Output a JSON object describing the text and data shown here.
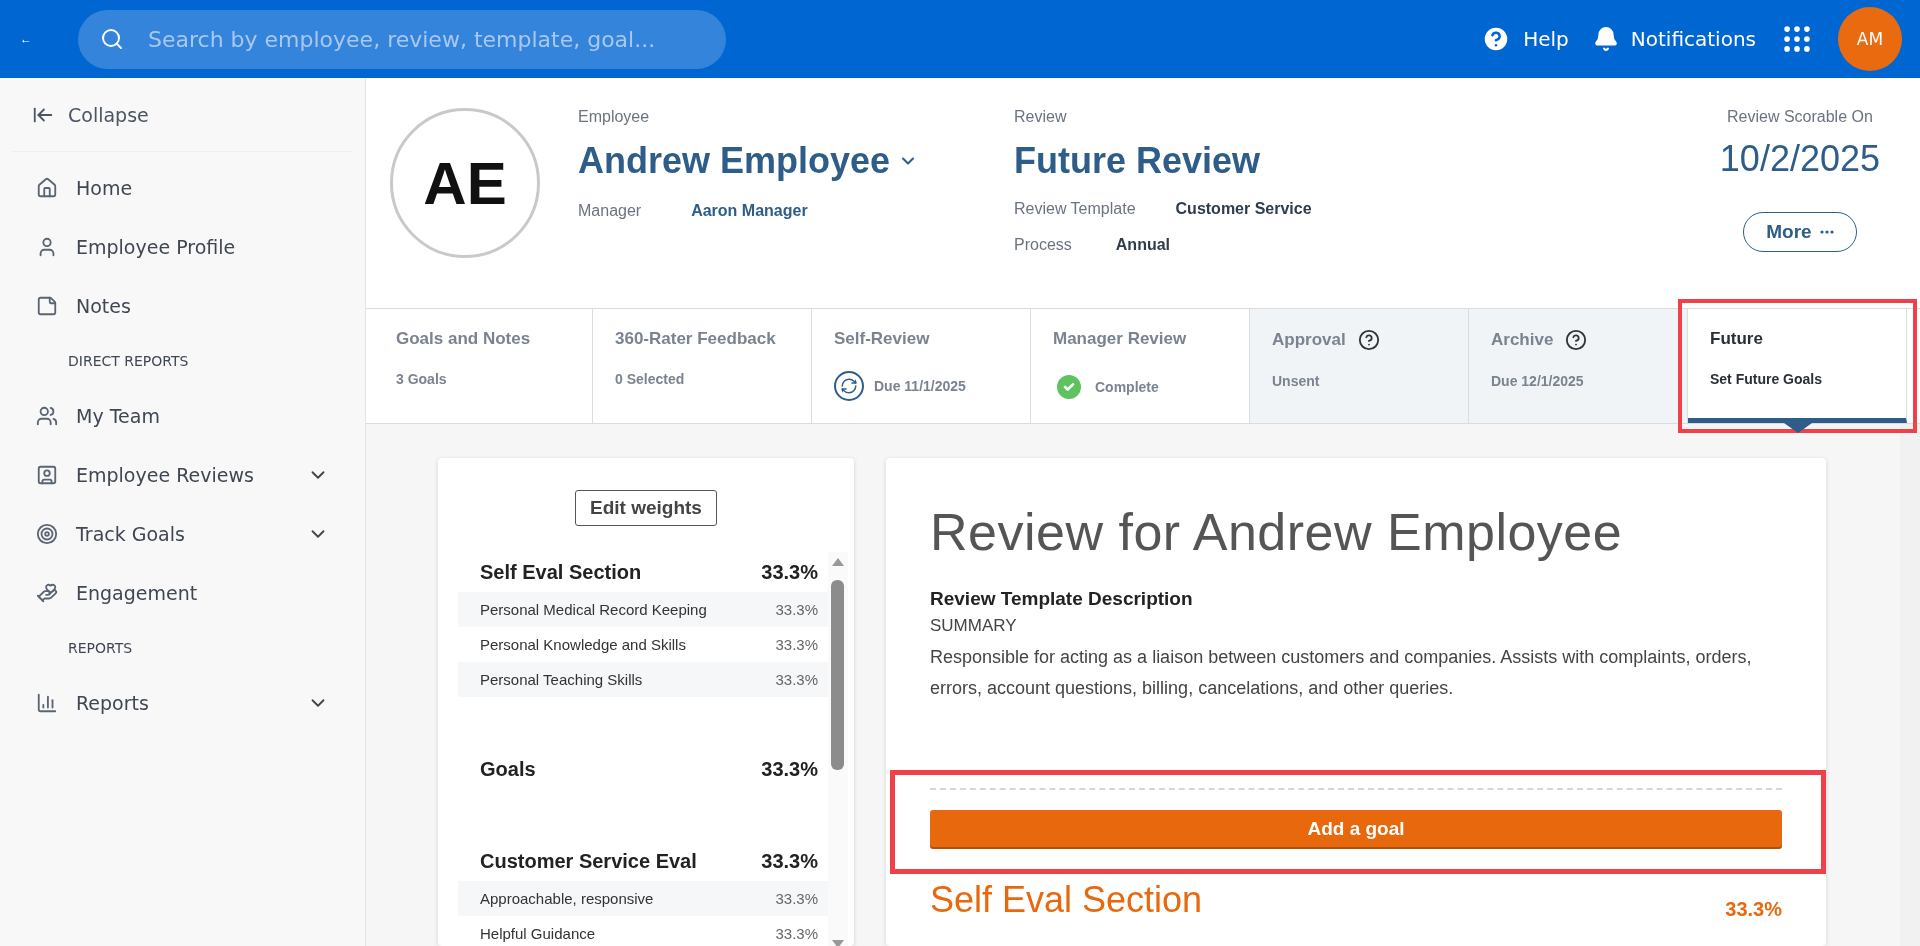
{
  "topbar": {
    "back": "←",
    "search": {
      "placeholder": "Search by employee, review, template, goal..."
    },
    "help": "Help",
    "notifications": "Notifications",
    "avatar": "AM"
  },
  "sidebar": {
    "collapse": "Collapse",
    "items": [
      {
        "kind": "link",
        "label": "Home",
        "expandable": false
      },
      {
        "kind": "link",
        "label": "Employee Profile",
        "expandable": false
      },
      {
        "kind": "link",
        "label": "Notes",
        "expandable": false
      },
      {
        "kind": "heading",
        "label": "DIRECT REPORTS"
      },
      {
        "kind": "link",
        "label": "My Team",
        "expandable": false
      },
      {
        "kind": "link",
        "label": "Employee Reviews",
        "expandable": true
      },
      {
        "kind": "link",
        "label": "Track Goals",
        "expandable": true
      },
      {
        "kind": "link",
        "label": "Engagement",
        "expandable": false
      },
      {
        "kind": "heading",
        "label": "REPORTS"
      },
      {
        "kind": "link",
        "label": "Reports",
        "expandable": true
      }
    ]
  },
  "header": {
    "avatar": "AE",
    "employee_label": "Employee",
    "employee_name": "Andrew Employee",
    "manager_label": "Manager",
    "manager": "Aaron Manager",
    "review_label": "Review",
    "review_name": "Future Review",
    "template_label": "Review Template",
    "template": "Customer Service",
    "process_label": "Process",
    "process": "Annual",
    "scorable_label": "Review Scorable On",
    "scorable_date": "10/2/2025",
    "more_button": "More"
  },
  "tabs": [
    {
      "title": "Goals and Notes",
      "subtitle": "3 Goals",
      "kind": "plain",
      "help": false,
      "disabled": false,
      "selected": false,
      "highlighted": false
    },
    {
      "title": "360-Rater Feedback",
      "subtitle": "0 Selected",
      "kind": "plain",
      "help": false,
      "disabled": false,
      "selected": false,
      "highlighted": false
    },
    {
      "title": "Self-Review",
      "subtitle": "Due 11/1/2025",
      "kind": "sync",
      "help": false,
      "disabled": false,
      "selected": false,
      "highlighted": false
    },
    {
      "title": "Manager Review",
      "subtitle": "Complete",
      "kind": "check",
      "help": false,
      "disabled": false,
      "selected": false,
      "highlighted": false
    },
    {
      "title": "Approval",
      "subtitle": "Unsent",
      "kind": "plain",
      "help": true,
      "disabled": true,
      "selected": false,
      "highlighted": false
    },
    {
      "title": "Archive",
      "subtitle": "Due 12/1/2025",
      "kind": "plain",
      "help": true,
      "disabled": true,
      "selected": false,
      "highlighted": false
    },
    {
      "title": "Future",
      "subtitle": "Set Future Goals",
      "kind": "plain",
      "help": false,
      "disabled": false,
      "selected": true,
      "highlighted": true
    }
  ],
  "weights": {
    "edit_button": "Edit weights",
    "sections": [
      {
        "title": "Self Eval Section",
        "weight": "33.3%",
        "items": [
          {
            "name": "Personal Medical Record Keeping",
            "weight": "33.3%"
          },
          {
            "name": "Personal Knowledge and Skills",
            "weight": "33.3%"
          },
          {
            "name": "Personal Teaching Skills",
            "weight": "33.3%"
          }
        ]
      },
      {
        "title": "Goals",
        "weight": "33.3%"
      },
      {
        "title": "Customer Service Eval",
        "weight": "33.3%",
        "items": [
          {
            "name": "Approachable, responsive",
            "weight": "33.3%"
          },
          {
            "name": "Helpful Guidance",
            "weight": "33.3%"
          }
        ]
      }
    ]
  },
  "review": {
    "title": "Review for Andrew Employee",
    "description_label": "Review Template Description",
    "summary_label": "SUMMARY",
    "summary": "Responsible for acting as a liaison between customers and companies. Assists with complaints, orders, errors, account questions, billing, cancelations, and other queries.",
    "add_goal": {
      "label": "Add a goal",
      "highlighted": true
    },
    "section_title": "Self Eval Section",
    "section_weight": "33.3%"
  }
}
